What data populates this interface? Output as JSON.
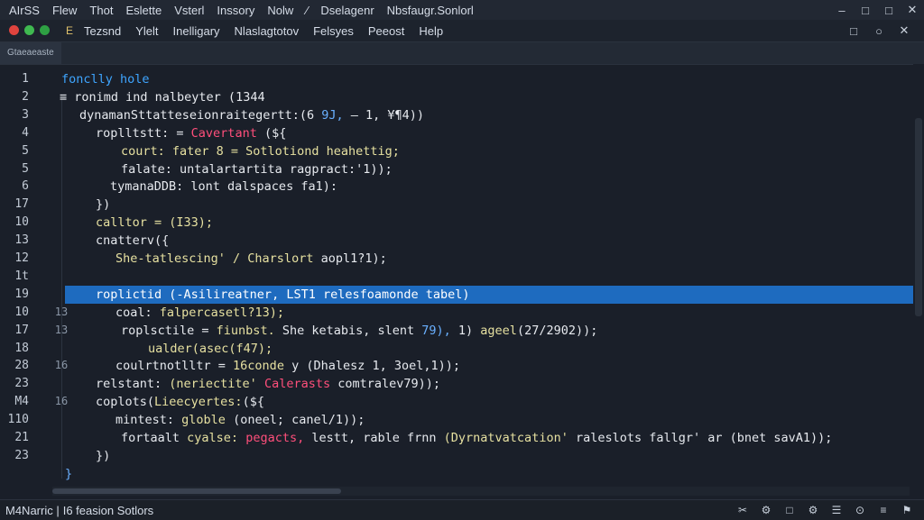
{
  "menubar": {
    "items": [
      "AIrSS",
      "Flew",
      "Thot",
      "Eslette",
      "Vsterl",
      "Inssory",
      "Nolw",
      "⁄",
      "Dselagenr",
      "Nbsfaugr.Sonlorl"
    ]
  },
  "window_controls": [
    "–",
    "□",
    "□",
    "✕"
  ],
  "toolbar": {
    "file_icon": "E",
    "items": [
      "Tezsnd",
      "Ylelt",
      "Inelligary",
      "Nlaslagtotov",
      "Felsyes",
      "Peeost",
      "Help"
    ],
    "dots": [
      "#e0443e",
      "#3fb950",
      "#2ea043"
    ],
    "right_icons": [
      "□",
      "○",
      "✕"
    ]
  },
  "tab": {
    "label": "Gtaeaeaste"
  },
  "gutter": {
    "numbers": [
      "1",
      "2",
      "3",
      "4",
      "5",
      "5",
      "6",
      "17",
      "10",
      "13",
      "12",
      "1t",
      "19",
      "10",
      "17",
      "18",
      "28",
      "23",
      "M4",
      "110",
      "21",
      "23"
    ],
    "marks": [
      "",
      "",
      "",
      "",
      "",
      "",
      "",
      "",
      "",
      "",
      "",
      "",
      "",
      "13",
      "13",
      "",
      "16",
      "",
      "16",
      "",
      "",
      ""
    ]
  },
  "code": {
    "lines": [
      [
        {
          "t": "fonclly hole",
          "c": "#3ea5ff"
        }
      ],
      [
        {
          "t": "≡ ronimd ind nalbeyter (1344",
          "c": "#e6e9ee"
        }
      ],
      [
        {
          "t": "dynamanSttatteseionraitegertt:(6 ",
          "c": "#e6e9ee"
        },
        {
          "t": "9J,",
          "c": "#6ab0ff"
        },
        {
          "t": " – 1, ¥¶4))",
          "c": "#e6e9ee"
        }
      ],
      [
        {
          "t": "roplltstt: = ",
          "c": "#e6e9ee"
        },
        {
          "t": "Cavertant",
          "c": "#ff4f7b"
        },
        {
          "t": " (${",
          "c": "#e6e9ee"
        }
      ],
      [
        {
          "t": "court: fater 8 = Sotlotiond heahettig;",
          "c": "#e6e0a0"
        }
      ],
      [
        {
          "t": "falate: untalartartita ragpract:'1));",
          "c": "#e6e9ee"
        }
      ],
      [
        {
          "t": "tymanaDDB: lont dalspaces fa1):",
          "c": "#e6e9ee"
        }
      ],
      [
        {
          "t": "})",
          "c": "#e6e9ee"
        }
      ],
      [
        {
          "t": "calltor = (I33);",
          "c": "#e6e0a0"
        }
      ],
      [
        {
          "t": "cnatterv({",
          "c": "#e6e9ee"
        }
      ],
      [
        {
          "t": "She-tatlescing' / Charslort ",
          "c": "#e6e0a0"
        },
        {
          "t": "aopl1?1);",
          "c": "#e6e9ee"
        }
      ],
      [
        {
          "t": "",
          "c": "#e6e9ee"
        }
      ],
      [
        {
          "t": "roplictid (-Asilireatner, LST1 relesfoamonde tabel)",
          "c": "#ffffff"
        }
      ],
      [
        {
          "t": "coal: ",
          "c": "#e6e9ee"
        },
        {
          "t": "falpercasetl?13);",
          "c": "#e6e0a0"
        }
      ],
      [
        {
          "t": "roplsctile = ",
          "c": "#e6e9ee"
        },
        {
          "t": "fiunbst.",
          "c": "#e6e0a0"
        },
        {
          "t": " She ketabis, slent ",
          "c": "#e6e9ee"
        },
        {
          "t": "79),",
          "c": "#6ab0ff"
        },
        {
          "t": " 1) ",
          "c": "#e6e9ee"
        },
        {
          "t": "ageel",
          "c": "#e6e0a0"
        },
        {
          "t": "(27/2902));",
          "c": "#e6e9ee"
        }
      ],
      [
        {
          "t": "ualder(asec(f47);",
          "c": "#e6e0a0"
        }
      ],
      [
        {
          "t": "coulrtnotlltr = ",
          "c": "#e6e9ee"
        },
        {
          "t": "16conde",
          "c": "#e6e0a0"
        },
        {
          "t": " y (Dhalesz 1, 3oel,1));",
          "c": "#e6e9ee"
        }
      ],
      [
        {
          "t": "relstant: ",
          "c": "#e6e9ee"
        },
        {
          "t": "(neriectite'",
          "c": "#e6e0a0"
        },
        {
          "t": " Calerasts",
          "c": "#ff4f7b"
        },
        {
          "t": " comtralev79));",
          "c": "#e6e9ee"
        }
      ],
      [
        {
          "t": "coplots(",
          "c": "#e6e9ee"
        },
        {
          "t": "Lieecyertes:",
          "c": "#e6e0a0"
        },
        {
          "t": "(${",
          "c": "#e6e9ee"
        }
      ],
      [
        {
          "t": "mintest: ",
          "c": "#e6e9ee"
        },
        {
          "t": "globle",
          "c": "#e6e0a0"
        },
        {
          "t": " (oneel; canel/1));",
          "c": "#e6e9ee"
        }
      ],
      [
        {
          "t": "fortaalt ",
          "c": "#e6e9ee"
        },
        {
          "t": "cyalse:",
          "c": "#e6e0a0"
        },
        {
          "t": " pegacts,",
          "c": "#ff4f7b"
        },
        {
          "t": " lestt, rable frnn ",
          "c": "#e6e9ee"
        },
        {
          "t": "(Dyrnatvatcation'",
          "c": "#e6e0a0"
        },
        {
          "t": " raleslots fallgr' ar (bnet savA1));",
          "c": "#e6e9ee"
        }
      ],
      [
        {
          "t": "})",
          "c": "#e6e9ee"
        }
      ],
      [
        {
          "t": "}",
          "c": "#6ab0ff"
        }
      ]
    ]
  },
  "statusbar": {
    "left": "M4Narric | ",
    "mid": "I6 feasion Sotlors",
    "right_icons": [
      "✂",
      "⚙",
      "□",
      "⚙",
      "☰",
      "⊙",
      "≡",
      "⚑"
    ]
  }
}
